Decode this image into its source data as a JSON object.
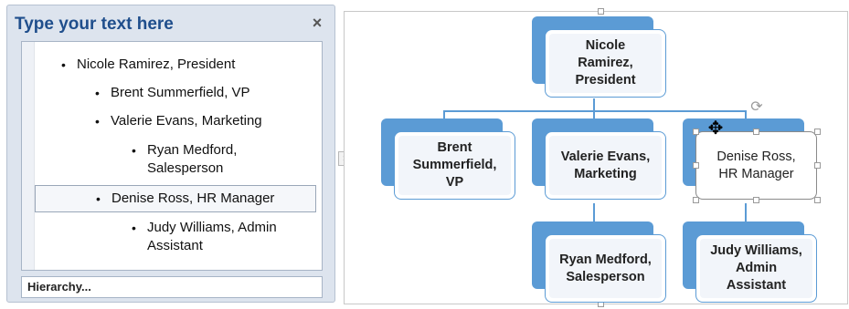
{
  "text_pane": {
    "title": "Type your text here",
    "close_glyph": "×",
    "bullet": "•",
    "items": [
      {
        "text": "Nicole Ramirez, President"
      },
      {
        "text": "Brent Summerfield, VP"
      },
      {
        "text": "Valerie Evans, Marketing"
      },
      {
        "line1": "Ryan Medford,",
        "line2": "Salesperson"
      },
      {
        "text": "Denise Ross, HR Manager"
      },
      {
        "line1": "Judy Williams, Admin",
        "line2": "Assistant"
      }
    ],
    "layout_name": "Hierarchy...",
    "toggle_glyph": "›"
  },
  "diagram": {
    "nodes": [
      {
        "lines": [
          "Nicole",
          "Ramirez,",
          "President"
        ]
      },
      {
        "lines": [
          "Brent",
          "Summerfield,",
          "VP"
        ]
      },
      {
        "lines": [
          "Valerie Evans,",
          "Marketing"
        ]
      },
      {
        "lines": [
          "Denise Ross,",
          "HR Manager"
        ]
      },
      {
        "lines": [
          "Ryan Medford,",
          "Salesperson"
        ]
      },
      {
        "lines": [
          "Judy Williams,",
          "Admin",
          "Assistant"
        ]
      }
    ],
    "rotate_glyph": "⟳",
    "move_glyph": "✥",
    "accent_color": "#5b9bd5"
  }
}
